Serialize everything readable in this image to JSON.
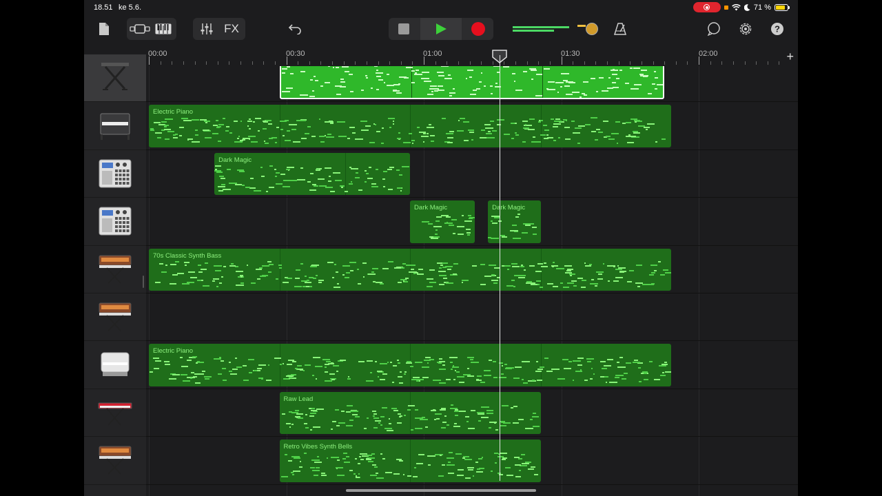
{
  "status_bar": {
    "time": "18.51",
    "date": "ke 5.6.",
    "battery": "71 %"
  },
  "toolbar": {
    "fx_label": "FX",
    "icons": [
      "document-icon",
      "view-toggle-icon",
      "keyboard-icon",
      "mixer-icon",
      "undo-icon",
      "stop-icon",
      "play-icon",
      "record-icon",
      "metronome-icon",
      "loop-icon",
      "settings-icon",
      "help-icon"
    ],
    "colors": {
      "play": "#3dd13a",
      "record": "#e60f1e",
      "region": "#1f6e1a",
      "region_selected": "#2fb82a",
      "note": "#8af57a"
    }
  },
  "ruler": {
    "labels": [
      "00:00",
      "00:30",
      "01:00",
      "01:30",
      "02:00"
    ],
    "add_label": "+"
  },
  "tracks": [
    {
      "name": "keyboard-stand",
      "instrument": "keyboard-stand-icon",
      "selected": true,
      "regions": [
        {
          "name": "",
          "start": 28.5,
          "end": 112.5,
          "selected": true
        }
      ]
    },
    {
      "name": "electric-piano-1",
      "instrument": "upright-piano-icon",
      "regions": [
        {
          "name": "Electric Piano",
          "start": 0,
          "end": 114
        }
      ]
    },
    {
      "name": "drum-machine-1",
      "instrument": "drum-machine-icon",
      "regions": [
        {
          "name": "Dark Magic",
          "start": 14.3,
          "end": 57
        }
      ]
    },
    {
      "name": "drum-machine-2",
      "instrument": "drum-machine-icon",
      "regions": [
        {
          "name": "Dark Magic",
          "start": 57,
          "end": 71.2
        },
        {
          "name": "Dark Magic",
          "start": 74,
          "end": 85.5
        }
      ]
    },
    {
      "name": "synth-bass",
      "instrument": "vintage-synth-icon",
      "regions": [
        {
          "name": "70s Classic Synth Bass",
          "start": 0,
          "end": 114
        }
      ]
    },
    {
      "name": "synth-empty",
      "instrument": "vintage-synth-icon",
      "regions": []
    },
    {
      "name": "electric-piano-2",
      "instrument": "electric-piano-icon",
      "regions": [
        {
          "name": "Electric Piano",
          "start": 0,
          "end": 114
        }
      ]
    },
    {
      "name": "raw-lead",
      "instrument": "red-synth-icon",
      "regions": [
        {
          "name": "Raw Lead",
          "start": 28.5,
          "end": 85.5
        }
      ]
    },
    {
      "name": "synth-bells",
      "instrument": "vintage-synth-icon",
      "regions": [
        {
          "name": "Retro Vibes Synth Bells",
          "start": 28.5,
          "end": 85.5
        }
      ]
    }
  ],
  "playhead_seconds": 76.5
}
